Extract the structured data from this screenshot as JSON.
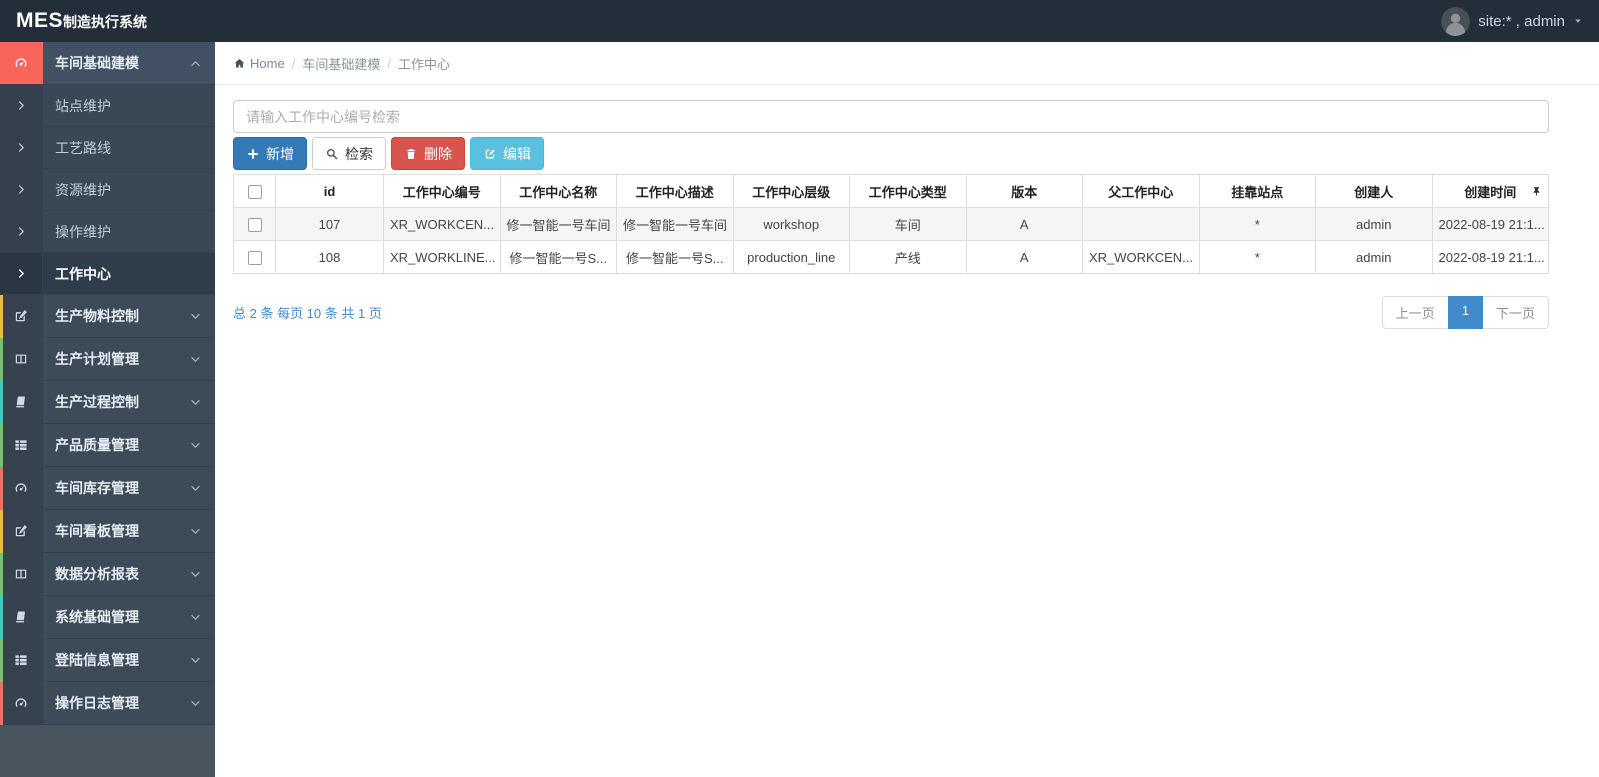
{
  "colors": {
    "topbar_bg": "#242e3a",
    "sidebar_bg": "#3d4b59",
    "active_icon_block": "#f9655b",
    "primary": "#337ab7",
    "danger": "#d9534f",
    "info": "#5bc0de",
    "link_blue": "#428bca"
  },
  "topbar": {
    "logo_bold": "MES",
    "logo_text": "制造执行系统",
    "user_label": "site:* , admin"
  },
  "sidebar": {
    "active_group": {
      "label": "车间基础建模",
      "icon": "dashboard-icon"
    },
    "submenu": [
      {
        "label": "站点维护",
        "active": false
      },
      {
        "label": "工艺路线",
        "active": false
      },
      {
        "label": "资源维护",
        "active": false
      },
      {
        "label": "操作维护",
        "active": false
      },
      {
        "label": "工作中心",
        "active": true
      }
    ],
    "groups": [
      {
        "label": "生产物料控制",
        "icon": "edit-icon",
        "strip_color": "#e9bd3d"
      },
      {
        "label": "生产计划管理",
        "icon": "columns-icon",
        "strip_color": "#74c274"
      },
      {
        "label": "生产过程控制",
        "icon": "book-icon",
        "strip_color": "#45c9c0"
      },
      {
        "label": "产品质量管理",
        "icon": "list-icon",
        "strip_color": "#74c274"
      },
      {
        "label": "车间库存管理",
        "icon": "dashboard-icon",
        "strip_color": "#ee6f66"
      },
      {
        "label": "车间看板管理",
        "icon": "edit-icon",
        "strip_color": "#e9bd3d"
      },
      {
        "label": "数据分析报表",
        "icon": "columns-icon",
        "strip_color": "#74c274"
      },
      {
        "label": "系统基础管理",
        "icon": "book-icon",
        "strip_color": "#45c9c0"
      },
      {
        "label": "登陆信息管理",
        "icon": "list-icon",
        "strip_color": "#74c274"
      },
      {
        "label": "操作日志管理",
        "icon": "dashboard-icon",
        "strip_color": "#ee6f66"
      }
    ]
  },
  "breadcrumb": {
    "separator": "/",
    "items": [
      "Home",
      "车间基础建模",
      "工作中心"
    ]
  },
  "search": {
    "placeholder": "请输入工作中心编号检索"
  },
  "toolbar": {
    "add_label": "新增",
    "search_label": "检索",
    "delete_label": "删除",
    "edit_label": "编辑"
  },
  "table": {
    "columns": [
      "id",
      "工作中心编号",
      "工作中心名称",
      "工作中心描述",
      "工作中心层级",
      "工作中心类型",
      "版本",
      "父工作中心",
      "挂靠站点",
      "创建人",
      "创建时间"
    ],
    "rows": [
      [
        "107",
        "XR_WORKCEN...",
        "修一智能一号车间",
        "修一智能一号车间",
        "workshop",
        "车间",
        "A",
        "",
        "*",
        "admin",
        "2022-08-19 21:1..."
      ],
      [
        "108",
        "XR_WORKLINE...",
        "修一智能一号S...",
        "修一智能一号S...",
        "production_line",
        "产线",
        "A",
        "XR_WORKCEN...",
        "*",
        "admin",
        "2022-08-19 21:1..."
      ]
    ]
  },
  "pagination": {
    "summary": "总 2 条 每页 10 条 共 1 页",
    "prev_label": "上一页",
    "page": "1",
    "next_label": "下一页"
  }
}
